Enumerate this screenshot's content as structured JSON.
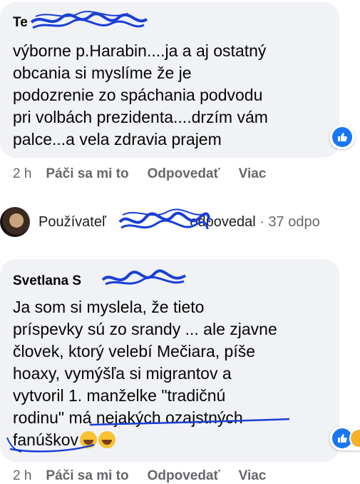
{
  "comments": [
    {
      "author": "Te",
      "author_redacted": "hidden name",
      "text_lines": [
        "výborne p.Harabin....ja a aj ostatný",
        "obcania si myslíme že je",
        "podozrenie zo spáchania podvodu",
        "pri volbách prezidenta....drzím vám",
        "palce...a vela zdravia prajem"
      ],
      "time": "2 h",
      "like": "Páči sa mi to",
      "reply": "Odpovedať",
      "more": "Viac"
    },
    {
      "author": "Svetlana S",
      "text_lines": [
        "Ja som si myslela, že tieto",
        "príspevky sú zo srandy ... ale zjavne",
        "človek, ktorý velebí Mečiara, píše",
        "hoaxy, vymýšľa si migrantov a",
        "vytvoril 1. manželke \"tradičnú",
        "rodinu\" má nejakých ozajstných",
        "fanúškov"
      ],
      "time": "2 h",
      "like": "Páči sa mi to",
      "reply": "Odpovedať",
      "more": "Viac"
    }
  ],
  "reply_summary": {
    "prefix": "Používateľ",
    "suffix": "odpovedal",
    "count": "· 37 odpo"
  },
  "colors": {
    "bubble": "#f0f2f5",
    "like_blue": "#1877f2",
    "scribble_blue": "#1a3fd6"
  }
}
